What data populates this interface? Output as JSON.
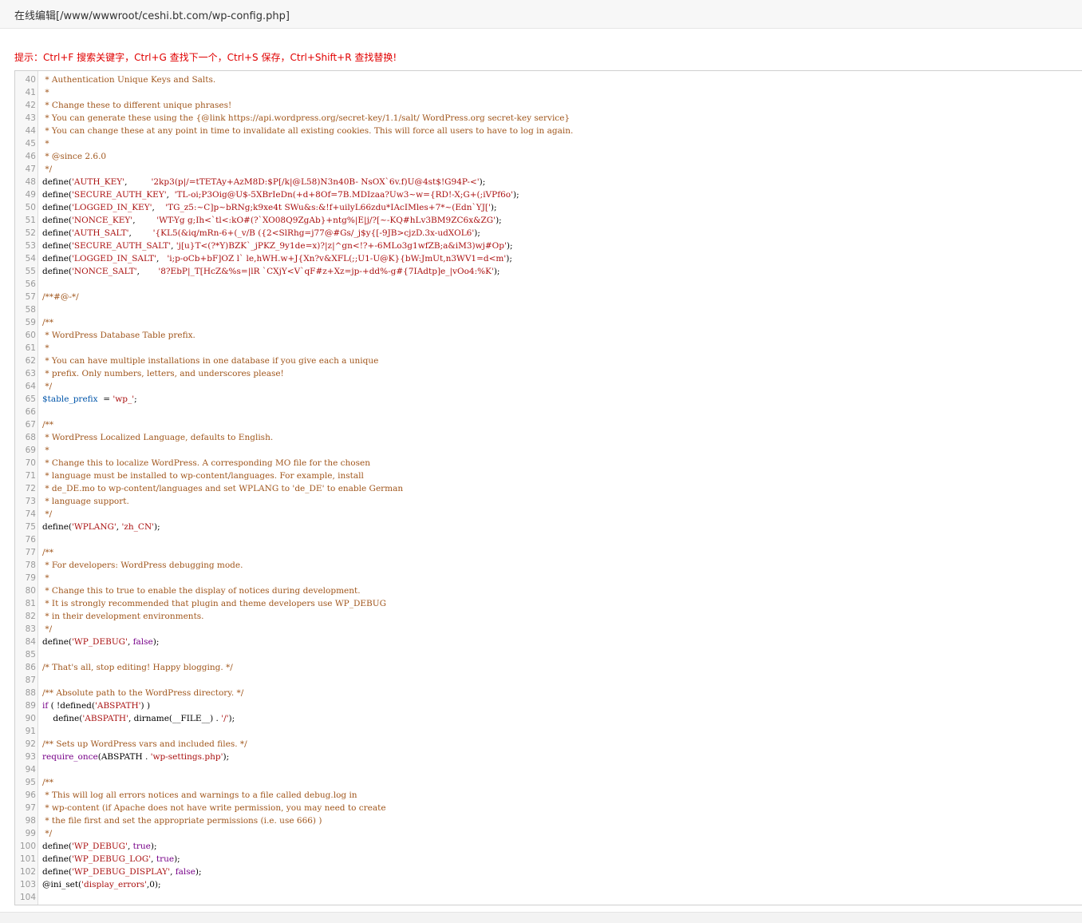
{
  "window": {
    "title": "在线编辑[/www/wwwroot/ceshi.bt.com/wp-config.php]"
  },
  "tip": "提示：Ctrl+F 搜索关键字，Ctrl+G 查找下一个，Ctrl+S 保存，Ctrl+Shift+R 查找替换!",
  "editor": {
    "file_path": "/www/wwwroot/ceshi.bt.com/wp-config.php",
    "lines": [
      {
        "n": "40",
        "t": [
          [
            "c",
            " * Authentication Unique Keys and Salts."
          ]
        ]
      },
      {
        "n": "41",
        "t": [
          [
            "c",
            " *"
          ]
        ]
      },
      {
        "n": "42",
        "t": [
          [
            "c",
            " * Change these to different unique phrases!"
          ]
        ]
      },
      {
        "n": "43",
        "t": [
          [
            "c",
            " * You can generate these using the {@link https://api.wordpress.org/secret-key/1.1/salt/ WordPress.org secret-key service}"
          ]
        ]
      },
      {
        "n": "44",
        "t": [
          [
            "c",
            " * You can change these at any point in time to invalidate all existing cookies. This will force all users to have to log in again."
          ]
        ]
      },
      {
        "n": "45",
        "t": [
          [
            "c",
            " *"
          ]
        ]
      },
      {
        "n": "46",
        "t": [
          [
            "c",
            " * @since 2.6.0"
          ]
        ]
      },
      {
        "n": "47",
        "t": [
          [
            "c",
            " */"
          ]
        ]
      },
      {
        "n": "48",
        "t": [
          [
            "f",
            "define"
          ],
          [
            "p",
            "("
          ],
          [
            "s",
            "'AUTH_KEY'"
          ],
          [
            "p",
            ",         "
          ],
          [
            "s",
            "'2kp3(p|/=tTETAy+AzM8D:$P[/k|@L58)N3n40B- NsOX`6v.f)U@4st$!G94P-<'"
          ],
          [
            "p",
            ");"
          ]
        ]
      },
      {
        "n": "49",
        "t": [
          [
            "f",
            "define"
          ],
          [
            "p",
            "("
          ],
          [
            "s",
            "'SECURE_AUTH_KEY'"
          ],
          [
            "p",
            ",  "
          ],
          [
            "s",
            "'TL-oi;P3Oig@U$-5XBrIeDn(+d+8Of=7B.MDIzaa?Uw3~w={RD!-X;G+(;iVPf6o'"
          ],
          [
            "p",
            ");"
          ]
        ]
      },
      {
        "n": "50",
        "t": [
          [
            "f",
            "define"
          ],
          [
            "p",
            "("
          ],
          [
            "s",
            "'LOGGED_IN_KEY'"
          ],
          [
            "p",
            ",    "
          ],
          [
            "s",
            "'TG_z5:~C]p~bRNg;k9xe4t SWu&s:&!f+uilyL66zdu*IAcIMles+7*~(Edn`YJ['"
          ],
          [
            "p",
            ");"
          ]
        ]
      },
      {
        "n": "51",
        "t": [
          [
            "f",
            "define"
          ],
          [
            "p",
            "("
          ],
          [
            "s",
            "'NONCE_KEY'"
          ],
          [
            "p",
            ",        "
          ],
          [
            "s",
            "'WT-Yg g;Ih<`tl<:kO#(?`XO08Q9ZgAb}+ntg%|E|j/?[~-KQ#hLv3BM9ZC6x&ZG'"
          ],
          [
            "p",
            ");"
          ]
        ]
      },
      {
        "n": "52",
        "t": [
          [
            "f",
            "define"
          ],
          [
            "p",
            "("
          ],
          [
            "s",
            "'AUTH_SALT'"
          ],
          [
            "p",
            ",        "
          ],
          [
            "s",
            "'{KL5(&iq/mRn-6+(_v/B ({2<SlRhg=j77@#Gs/_j$y{[-9JB>cjzD.3x-udXOL6'"
          ],
          [
            "p",
            ");"
          ]
        ]
      },
      {
        "n": "53",
        "t": [
          [
            "f",
            "define"
          ],
          [
            "p",
            "("
          ],
          [
            "s",
            "'SECURE_AUTH_SALT'"
          ],
          [
            "p",
            ", "
          ],
          [
            "s",
            "'j[u}T<(?*Y)BZK`_jPKZ_9y1de=x)?|z|^gn<!?+-6MLo3g1wfZB;a&iM3)wj#Op'"
          ],
          [
            "p",
            ");"
          ]
        ]
      },
      {
        "n": "54",
        "t": [
          [
            "f",
            "define"
          ],
          [
            "p",
            "("
          ],
          [
            "s",
            "'LOGGED_IN_SALT'"
          ],
          [
            "p",
            ",   "
          ],
          [
            "s",
            "'i;p-oCb+bF]OZ l` le,hWH.w+J{Xn?v&XFL(;;U1-U@K}{bW:JmUt,n3WV1=d<m'"
          ],
          [
            "p",
            ");"
          ]
        ]
      },
      {
        "n": "55",
        "t": [
          [
            "f",
            "define"
          ],
          [
            "p",
            "("
          ],
          [
            "s",
            "'NONCE_SALT'"
          ],
          [
            "p",
            ",       "
          ],
          [
            "s",
            "'8?EbP|_T[HcZ&%s=|lR `CXjY<V`qF#z+Xz=jp-+dd%-g#{7IAdtp]e_|vOo4:%K'"
          ],
          [
            "p",
            ");"
          ]
        ]
      },
      {
        "n": "56",
        "t": []
      },
      {
        "n": "57",
        "t": [
          [
            "c",
            "/**#@-*/"
          ]
        ]
      },
      {
        "n": "58",
        "t": []
      },
      {
        "n": "59",
        "t": [
          [
            "c",
            "/**"
          ]
        ]
      },
      {
        "n": "60",
        "t": [
          [
            "c",
            " * WordPress Database Table prefix."
          ]
        ]
      },
      {
        "n": "61",
        "t": [
          [
            "c",
            " *"
          ]
        ]
      },
      {
        "n": "62",
        "t": [
          [
            "c",
            " * You can have multiple installations in one database if you give each a unique"
          ]
        ]
      },
      {
        "n": "63",
        "t": [
          [
            "c",
            " * prefix. Only numbers, letters, and underscores please!"
          ]
        ]
      },
      {
        "n": "64",
        "t": [
          [
            "c",
            " */"
          ]
        ]
      },
      {
        "n": "65",
        "t": [
          [
            "v",
            "$table_prefix"
          ],
          [
            "p",
            "  = "
          ],
          [
            "s",
            "'wp_'"
          ],
          [
            "p",
            ";"
          ]
        ]
      },
      {
        "n": "66",
        "t": []
      },
      {
        "n": "67",
        "t": [
          [
            "c",
            "/**"
          ]
        ]
      },
      {
        "n": "68",
        "t": [
          [
            "c",
            " * WordPress Localized Language, defaults to English."
          ]
        ]
      },
      {
        "n": "69",
        "t": [
          [
            "c",
            " *"
          ]
        ]
      },
      {
        "n": "70",
        "t": [
          [
            "c",
            " * Change this to localize WordPress. A corresponding MO file for the chosen"
          ]
        ]
      },
      {
        "n": "71",
        "t": [
          [
            "c",
            " * language must be installed to wp-content/languages. For example, install"
          ]
        ]
      },
      {
        "n": "72",
        "t": [
          [
            "c",
            " * de_DE.mo to wp-content/languages and set WPLANG to 'de_DE' to enable German"
          ]
        ]
      },
      {
        "n": "73",
        "t": [
          [
            "c",
            " * language support."
          ]
        ]
      },
      {
        "n": "74",
        "t": [
          [
            "c",
            " */"
          ]
        ]
      },
      {
        "n": "75",
        "t": [
          [
            "f",
            "define"
          ],
          [
            "p",
            "("
          ],
          [
            "s",
            "'WPLANG'"
          ],
          [
            "p",
            ", "
          ],
          [
            "s",
            "'zh_CN'"
          ],
          [
            "p",
            ");"
          ]
        ]
      },
      {
        "n": "76",
        "t": []
      },
      {
        "n": "77",
        "t": [
          [
            "c",
            "/**"
          ]
        ]
      },
      {
        "n": "78",
        "t": [
          [
            "c",
            " * For developers: WordPress debugging mode."
          ]
        ]
      },
      {
        "n": "79",
        "t": [
          [
            "c",
            " *"
          ]
        ]
      },
      {
        "n": "80",
        "t": [
          [
            "c",
            " * Change this to true to enable the display of notices during development."
          ]
        ]
      },
      {
        "n": "81",
        "t": [
          [
            "c",
            " * It is strongly recommended that plugin and theme developers use WP_DEBUG"
          ]
        ]
      },
      {
        "n": "82",
        "t": [
          [
            "c",
            " * in their development environments."
          ]
        ]
      },
      {
        "n": "83",
        "t": [
          [
            "c",
            " */"
          ]
        ]
      },
      {
        "n": "84",
        "t": [
          [
            "f",
            "define"
          ],
          [
            "p",
            "("
          ],
          [
            "s",
            "'WP_DEBUG'"
          ],
          [
            "p",
            ", "
          ],
          [
            "k",
            "false"
          ],
          [
            "p",
            ");"
          ]
        ]
      },
      {
        "n": "85",
        "t": []
      },
      {
        "n": "86",
        "t": [
          [
            "c",
            "/* That's all, stop editing! Happy blogging. */"
          ]
        ]
      },
      {
        "n": "87",
        "t": []
      },
      {
        "n": "88",
        "t": [
          [
            "c",
            "/** Absolute path to the WordPress directory. */"
          ]
        ]
      },
      {
        "n": "89",
        "t": [
          [
            "k",
            "if"
          ],
          [
            "p",
            " ( !defined("
          ],
          [
            "s",
            "'ABSPATH'"
          ],
          [
            "p",
            ") )"
          ]
        ]
      },
      {
        "n": "90",
        "t": [
          [
            "p",
            "    "
          ],
          [
            "f",
            "define"
          ],
          [
            "p",
            "("
          ],
          [
            "s",
            "'ABSPATH'"
          ],
          [
            "p",
            ", dirname(__FILE__) . "
          ],
          [
            "s",
            "'/'"
          ],
          [
            "p",
            ");"
          ]
        ]
      },
      {
        "n": "91",
        "t": []
      },
      {
        "n": "92",
        "t": [
          [
            "c",
            "/** Sets up WordPress vars and included files. */"
          ]
        ]
      },
      {
        "n": "93",
        "t": [
          [
            "k",
            "require_once"
          ],
          [
            "p",
            "(ABSPATH . "
          ],
          [
            "s",
            "'wp-settings.php'"
          ],
          [
            "p",
            ");"
          ]
        ]
      },
      {
        "n": "94",
        "t": []
      },
      {
        "n": "95",
        "t": [
          [
            "c",
            "/**"
          ]
        ]
      },
      {
        "n": "96",
        "t": [
          [
            "c",
            " * This will log all errors notices and warnings to a file called debug.log in"
          ]
        ]
      },
      {
        "n": "97",
        "t": [
          [
            "c",
            " * wp-content (if Apache does not have write permission, you may need to create"
          ]
        ]
      },
      {
        "n": "98",
        "t": [
          [
            "c",
            " * the file first and set the appropriate permissions (i.e. use 666) )"
          ]
        ]
      },
      {
        "n": "99",
        "t": [
          [
            "c",
            " */"
          ]
        ]
      },
      {
        "n": "100",
        "t": [
          [
            "f",
            "define"
          ],
          [
            "p",
            "("
          ],
          [
            "s",
            "'WP_DEBUG'"
          ],
          [
            "p",
            ", "
          ],
          [
            "k",
            "true"
          ],
          [
            "p",
            ");"
          ]
        ]
      },
      {
        "n": "101",
        "t": [
          [
            "f",
            "define"
          ],
          [
            "p",
            "("
          ],
          [
            "s",
            "'WP_DEBUG_LOG'"
          ],
          [
            "p",
            ", "
          ],
          [
            "k",
            "true"
          ],
          [
            "p",
            ");"
          ]
        ]
      },
      {
        "n": "102",
        "t": [
          [
            "f",
            "define"
          ],
          [
            "p",
            "("
          ],
          [
            "s",
            "'WP_DEBUG_DISPLAY'"
          ],
          [
            "p",
            ", "
          ],
          [
            "k",
            "false"
          ],
          [
            "p",
            ");"
          ]
        ]
      },
      {
        "n": "103",
        "t": [
          [
            "p",
            "@ini_set("
          ],
          [
            "s",
            "'display_errors'"
          ],
          [
            "p",
            ",0);"
          ]
        ]
      },
      {
        "n": "104",
        "t": []
      }
    ]
  },
  "colors": {
    "tip": "#e00000",
    "comment": "#a0561c",
    "string": "#aa1111",
    "keyword": "#770088",
    "variable": "#0055aa",
    "line_number": "#999999"
  }
}
